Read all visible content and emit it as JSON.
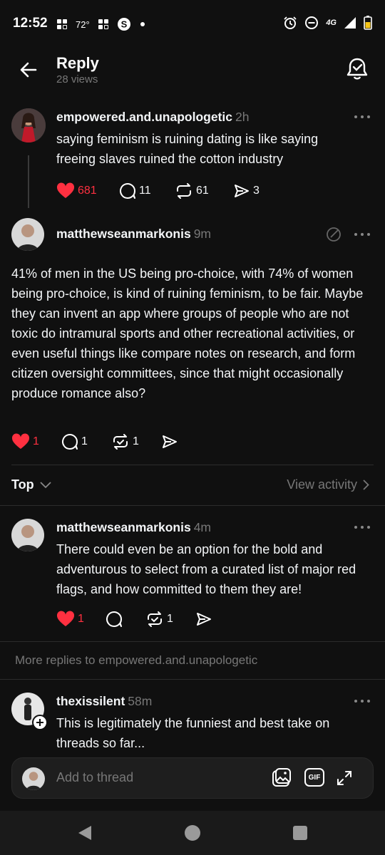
{
  "status_bar": {
    "time": "12:52",
    "temperature": "72°",
    "network": "4G"
  },
  "header": {
    "title": "Reply",
    "views": "28 views"
  },
  "parent_post": {
    "username": "empowered.and.unapologetic",
    "time": "2h",
    "text": "saying feminism is ruining dating is like saying freeing slaves ruined the cotton industry",
    "likes": "681",
    "replies": "11",
    "reposts": "61",
    "shares": "3"
  },
  "main_post": {
    "username": "matthewseanmarkonis",
    "time": "9m",
    "text": "41% of men in the US being pro-choice, with 74% of women being pro-choice, is kind of ruining feminism, to be fair. Maybe they can invent an app where groups of people who are not toxic do intramural sports and other recreational activities, or even useful things like compare notes on research, and form citizen oversight committees, since that might occasionally produce romance also?",
    "likes": "1",
    "replies": "1",
    "reposts": "1"
  },
  "sort": {
    "label": "Top",
    "view_activity": "View activity"
  },
  "reply_post": {
    "username": "matthewseanmarkonis",
    "time": "4m",
    "text": "There could even be an option for the bold and adventurous to select from a curated list of major red flags, and how committed to them they are!",
    "likes": "1",
    "reposts": "1"
  },
  "more_replies": {
    "label": "More replies to empowered.and.unapologetic"
  },
  "other_reply": {
    "username": "thexissilent",
    "time": "58m",
    "text": "This is legitimately the funniest and best take on threads so far..."
  },
  "composer": {
    "placeholder": "Add to thread",
    "gif_label": "GIF"
  },
  "colors": {
    "background": "#101010",
    "like_red": "#ff3040",
    "muted": "#777777"
  }
}
